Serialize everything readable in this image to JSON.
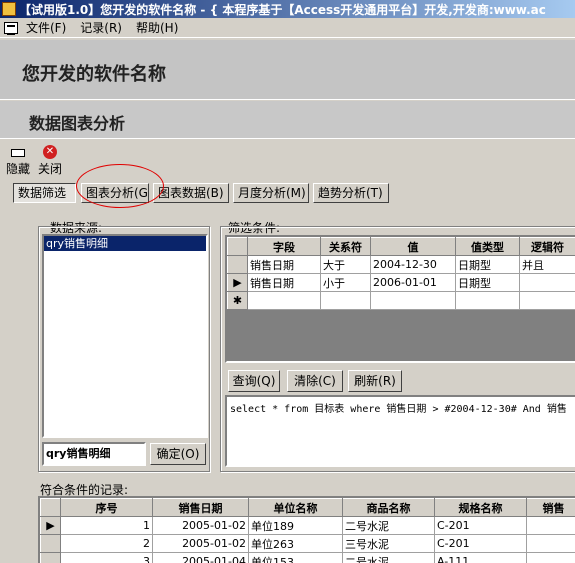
{
  "window": {
    "title": "【试用版1.0】您开发的软件名称 - { 本程序基于【Access开发通用平台】开发,开发商:www.ac"
  },
  "menu": {
    "items": [
      {
        "label": "文件(F)"
      },
      {
        "label": "记录(R)"
      },
      {
        "label": "帮助(H)"
      }
    ]
  },
  "header": {
    "software_name": "您开发的软件名称",
    "section_title": "数据图表分析"
  },
  "toolbar": {
    "hide_label": "隐藏",
    "close_label": "关闭"
  },
  "tabs": [
    {
      "label": "数据筛选",
      "active": true
    },
    {
      "label": "图表分析(G)"
    },
    {
      "label": "图表数据(B)"
    },
    {
      "label": "月度分析(M)"
    },
    {
      "label": "趋势分析(T)"
    }
  ],
  "source": {
    "label": "数据来源:",
    "items": [
      "qry销售明细"
    ],
    "input_value": "qry销售明细",
    "confirm_label": "确定(O)"
  },
  "filter": {
    "label": "筛选条件:",
    "columns": [
      "字段",
      "关系符",
      "值",
      "值类型",
      "逻辑符"
    ],
    "rows": [
      {
        "field": "销售日期",
        "op": "大于",
        "value": "2004-12-30",
        "type": "日期型",
        "logic": "并且"
      },
      {
        "field": "销售日期",
        "op": "小于",
        "value": "2006-01-01",
        "type": "日期型",
        "logic": ""
      }
    ],
    "query_label": "查询(Q)",
    "clear_label": "清除(C)",
    "refresh_label": "刷新(R)",
    "sql": "select * from 目标表 where 销售日期 > #2004-12-30# And 销售"
  },
  "records": {
    "label": "符合条件的记录:",
    "columns": [
      "序号",
      "销售日期",
      "单位名称",
      "商品名称",
      "规格名称",
      "销售"
    ],
    "rows": [
      {
        "no": "1",
        "date": "2005-01-02",
        "unit": "单位189",
        "product": "二号水泥",
        "spec": "C-201"
      },
      {
        "no": "2",
        "date": "2005-01-02",
        "unit": "单位263",
        "product": "三号水泥",
        "spec": "C-201"
      },
      {
        "no": "3",
        "date": "2005-01-04",
        "unit": "单位153",
        "product": "二号水泥",
        "spec": "A-111"
      }
    ]
  },
  "colors": {
    "title_bar": "#0a246a",
    "selection": "#0a246a",
    "highlight_oval": "#e00000",
    "window_bg": "#d4d0c8"
  }
}
